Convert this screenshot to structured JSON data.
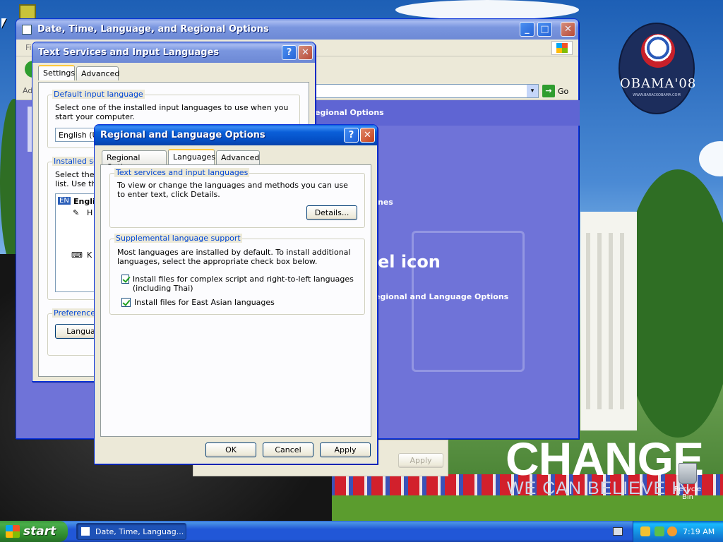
{
  "desktop": {
    "logo_text": "OBAMA'08",
    "logo_url": "WWW.BARACKOBAMA.COM",
    "wallpaper_headline": "CHANGE",
    "wallpaper_tagline": "WE CAN BELIEVE IN",
    "recycle_bin_label": "Recycle Bin"
  },
  "control_panel": {
    "title": "Date, Time, Language, and Regional Options",
    "menu_first": "Fi",
    "address_label": "Ad",
    "go_label": "Go",
    "task_text_1": "egional Options",
    "task_text_2": "nes",
    "heading": "el icon",
    "task_text_3": "egional and Language Options",
    "apply_label": "Apply"
  },
  "text_services": {
    "title": "Text Services and Input Languages",
    "tabs": [
      "Settings",
      "Advanced"
    ],
    "default_group_label": "Default input language",
    "default_desc": "Select one of the installed input languages to use when you start your computer.",
    "default_value": "English (Ur",
    "installed_group_label": "Installed se",
    "installed_desc_1": "Select the s",
    "installed_desc_2": "list. Use the",
    "lang_code": "EN",
    "lang_name": "Engli",
    "item_h": "H",
    "item_k": "K",
    "preferences_label": "Preferences",
    "language_bar_button": "Languag"
  },
  "regional": {
    "title": "Regional and Language Options",
    "tabs": [
      "Regional Options",
      "Languages",
      "Advanced"
    ],
    "active_tab": "Languages",
    "ts_group_label": "Text services and input languages",
    "ts_desc": "To view or change the languages and methods you can use to enter text, click Details.",
    "details_button": "Details...",
    "supp_group_label": "Supplemental language support",
    "supp_desc": "Most languages are installed by default. To install additional languages, select the appropriate check box below.",
    "check_complex": "Install files for complex script and right-to-left languages (including Thai)",
    "check_complex_checked": true,
    "check_east_asian": "Install files for East Asian languages",
    "check_east_asian_checked": true,
    "ok_button": "OK",
    "cancel_button": "Cancel",
    "apply_button": "Apply"
  },
  "taskbar": {
    "start_label": "start",
    "task_button": "Date, Time, Languag...",
    "clock": "7:19 AM"
  },
  "colors": {
    "xp_blue": "#0a5fd8",
    "start_green": "#3c9a3c",
    "group_title_blue": "#0046d5"
  }
}
